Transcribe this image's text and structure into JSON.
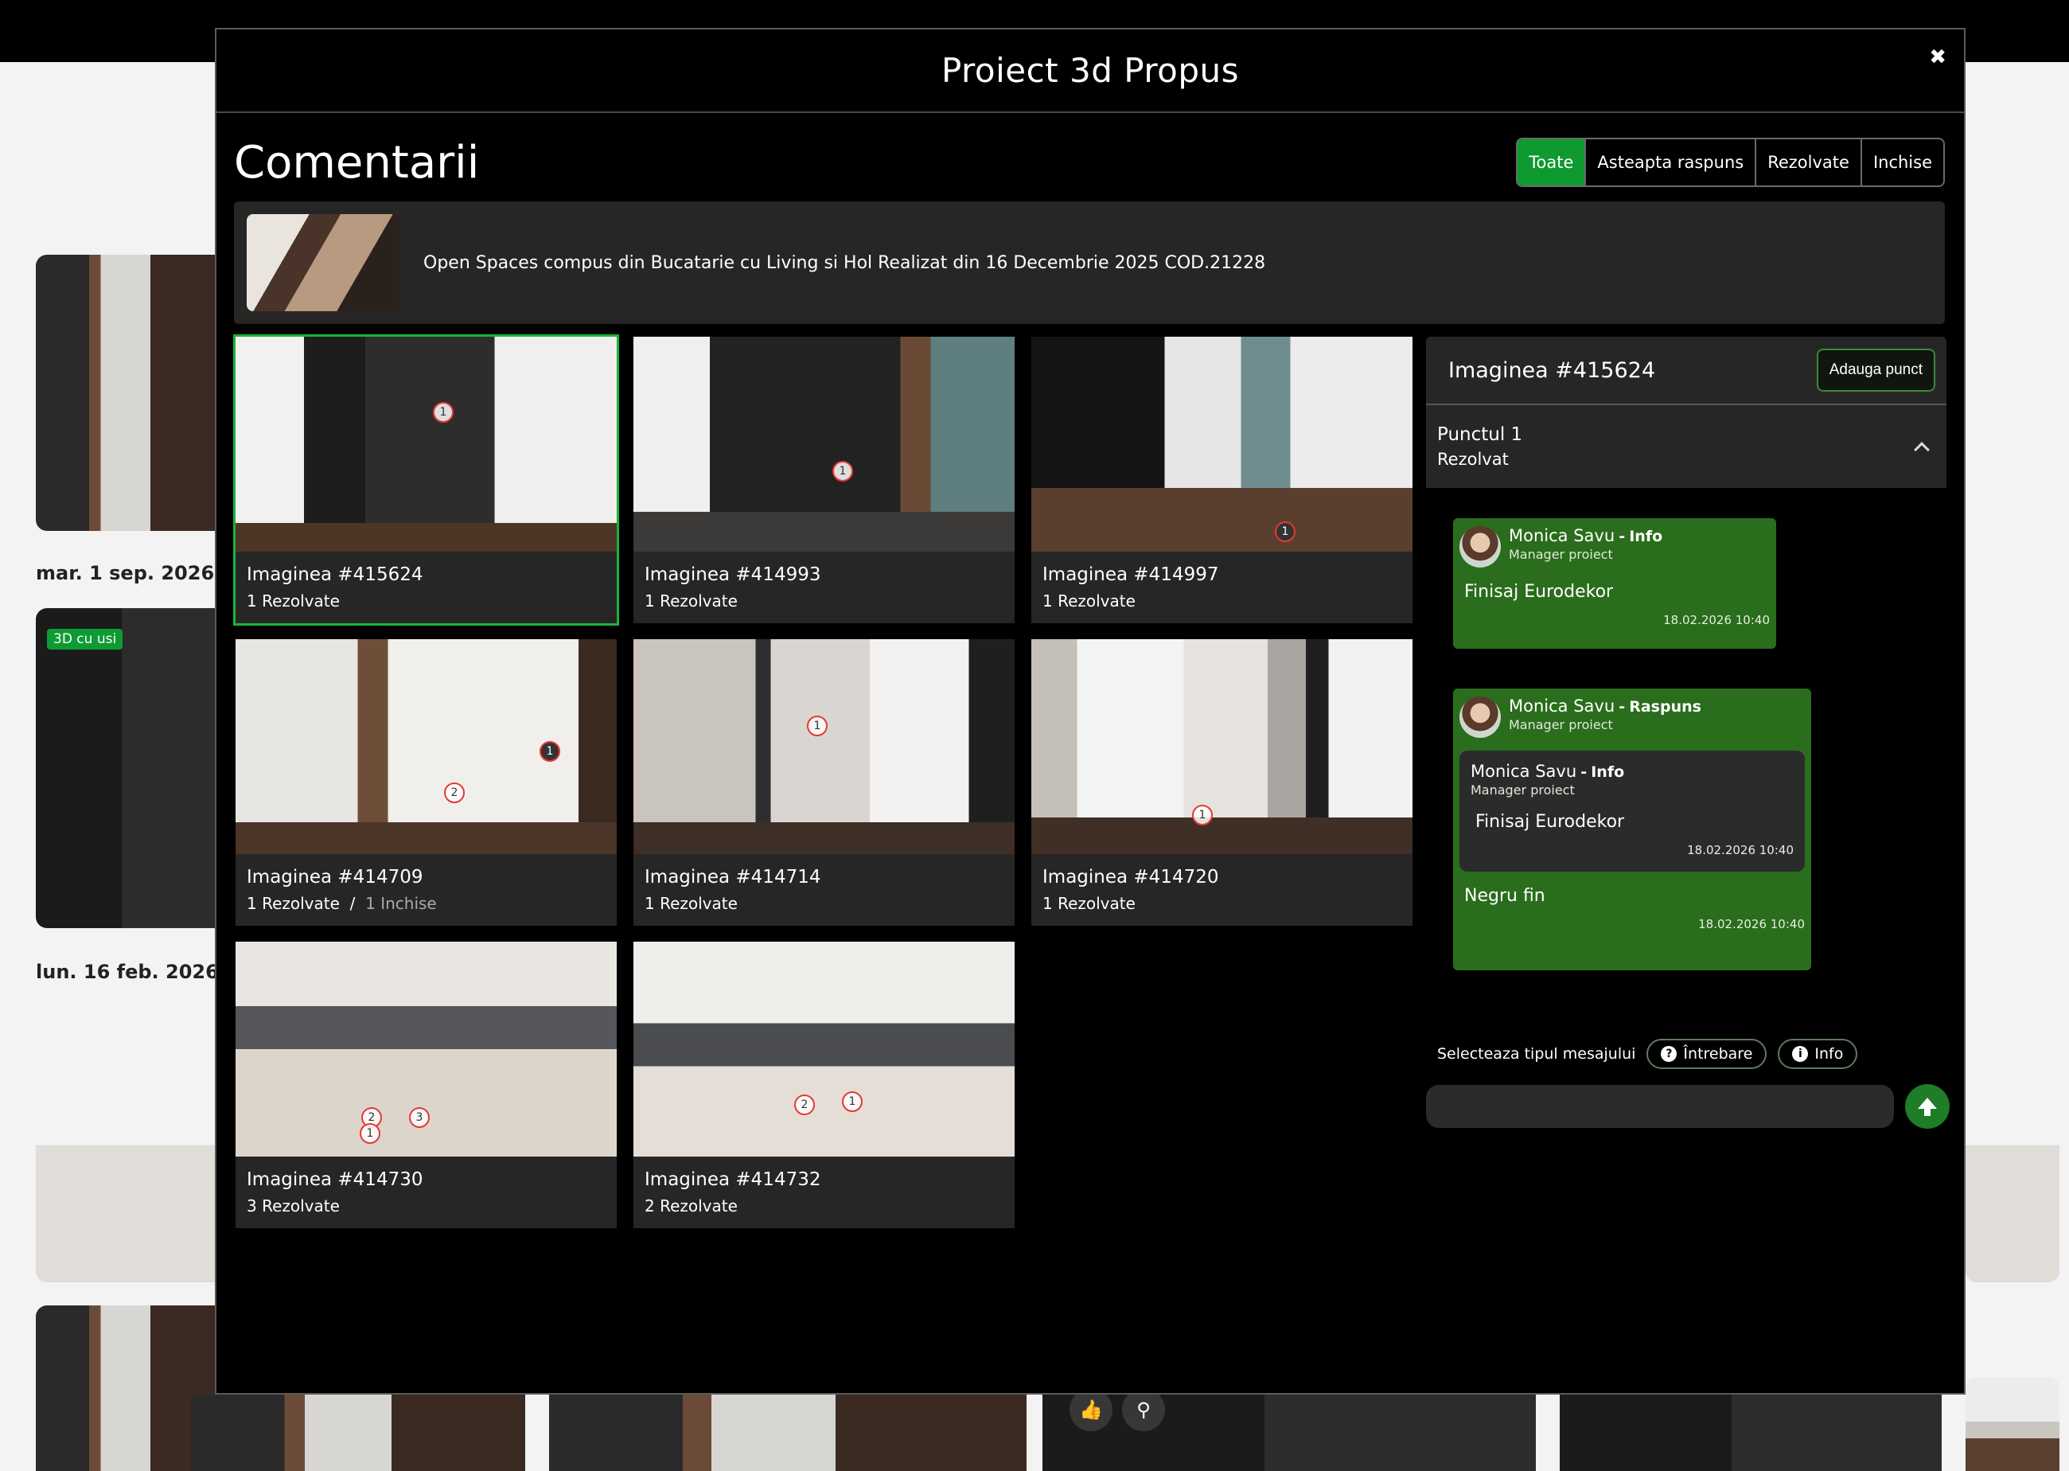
{
  "background": {
    "dates": [
      "mar.  1 sep. 2026",
      "lun. 16 feb. 2026"
    ],
    "badge": "3D cu usi"
  },
  "modal": {
    "title": "Proiect 3d Propus",
    "close_icon": "✖"
  },
  "comments": {
    "title": "Comentarii",
    "filters": [
      {
        "label": "Toate",
        "active": true
      },
      {
        "label": "Asteapta raspuns",
        "active": false
      },
      {
        "label": "Rezolvate",
        "active": false
      },
      {
        "label": "Inchise",
        "active": false
      }
    ]
  },
  "project": {
    "name": "Open Spaces compus din Bucatarie cu Living si Hol Realizat din 16 Decembrie 2025 COD.21228"
  },
  "images": [
    {
      "title": "Imaginea #415624",
      "status": "1 Rezolvate",
      "status2": "",
      "selected": true
    },
    {
      "title": "Imaginea #414993",
      "status": "1 Rezolvate",
      "status2": ""
    },
    {
      "title": "Imaginea #414997",
      "status": "1 Rezolvate",
      "status2": ""
    },
    {
      "title": "Imaginea #414709",
      "status": "1 Rezolvate",
      "separator": "/",
      "status2": "1 Inchise"
    },
    {
      "title": "Imaginea #414714",
      "status": "1 Rezolvate",
      "status2": ""
    },
    {
      "title": "Imaginea #414720",
      "status": "1 Rezolvate",
      "status2": ""
    },
    {
      "title": "Imaginea #414730",
      "status": "3 Rezolvate",
      "status2": ""
    },
    {
      "title": "Imaginea #414732",
      "status": "2 Rezolvate",
      "status2": ""
    }
  ],
  "pins": {
    "one": "1",
    "two": "2",
    "three": "3"
  },
  "panel": {
    "title": "Imaginea #415624",
    "add_point": "Adauga punct",
    "point": {
      "name": "Punctul 1",
      "status": "Rezolvat"
    },
    "messages": [
      {
        "author": "Monica Savu",
        "dash": "-",
        "type": "Info",
        "role": "Manager proiect",
        "text": "Finisaj Eurodekor",
        "time": "18.02.2026 10:40"
      },
      {
        "author": "Monica Savu",
        "dash": "-",
        "type": "Raspuns",
        "role": "Manager proiect",
        "quote": {
          "author": "Monica Savu",
          "dash": "-",
          "type": "Info",
          "role": "Manager proiect",
          "text": "Finisaj Eurodekor",
          "time": "18.02.2026 10:40"
        },
        "text": "Negru fin",
        "time": "18.02.2026 10:40"
      }
    ],
    "type_label": "Selecteaza tipul mesajului",
    "type_options": [
      {
        "label": "Întrebare",
        "icon": "?"
      },
      {
        "label": "Info",
        "icon": "i"
      }
    ],
    "input_placeholder": ""
  },
  "colors": {
    "accent_green": "#0e9a2e",
    "message_green": "#2a6d1c",
    "panel_bg": "#262626"
  }
}
